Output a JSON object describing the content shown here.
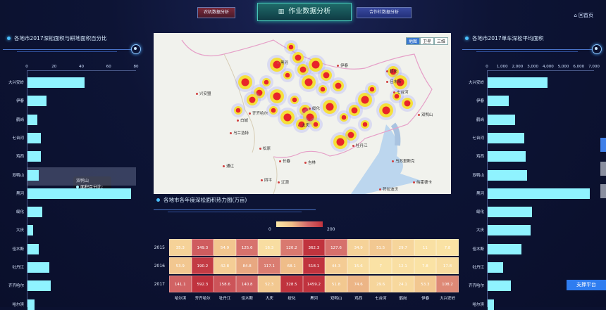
{
  "header": {
    "left_button": "农机数据分析",
    "main_button": "作业数据分析",
    "right_button": "合作社数据分析",
    "home_link": "回首页"
  },
  "left_panel": {
    "title": "各地市2017深松面积与耕地面积百分比",
    "axis_ticks": [
      "0",
      "20",
      "40",
      "60",
      "80"
    ],
    "tooltip": {
      "city": "双鸭山",
      "label": "面积百分比: 8.4"
    }
  },
  "right_panel": {
    "title": "各地市2017单车深松平均面积",
    "axis_ticks": [
      "0",
      "1,000",
      "2,000",
      "3,000",
      "4,000",
      "5,000",
      "6,000",
      "7,000"
    ]
  },
  "heatmap": {
    "title": "各地市各年度深松面积热力图(万亩)",
    "legend_min": "0",
    "legend_max": "200"
  },
  "map": {
    "toggle": [
      "地图",
      "卫星",
      "三维"
    ],
    "cities": [
      "伊春",
      "齐齐哈尔",
      "佳木斯",
      "牡丹江",
      "大庆",
      "长春",
      "绥化",
      "双鸭山",
      "鹤岗",
      "七台河",
      "白城",
      "松原",
      "四平",
      "吉林",
      "辽源",
      "通辽",
      "兴安盟",
      "乌苏里斯克",
      "纳霍德卡",
      "乌兰浩特",
      "符拉迪沃",
      "黑河"
    ]
  },
  "support_button": "支撑平台",
  "chart_data": [
    {
      "type": "bar",
      "title": "各地市2017深松面积与耕地面积百分比",
      "categories": [
        "大兴安岭",
        "伊春",
        "鹤岗",
        "七台河",
        "鸡西",
        "双鸭山",
        "黑河",
        "绥化",
        "大庆",
        "佳木斯",
        "牡丹江",
        "齐齐哈尔",
        "哈尔滨"
      ],
      "values": [
        42,
        14,
        7,
        10,
        10,
        8.4,
        76,
        11,
        4,
        8,
        16,
        17,
        5
      ],
      "xlim": [
        0,
        80
      ],
      "orientation": "horizontal"
    },
    {
      "type": "bar",
      "title": "各地市2017单车深松平均面积",
      "categories": [
        "大兴安岭",
        "伊春",
        "鹤岗",
        "七台河",
        "鸡西",
        "双鸭山",
        "黑河",
        "绥化",
        "大庆",
        "佳木斯",
        "牡丹江",
        "齐齐哈尔",
        "哈尔滨"
      ],
      "values": [
        3900,
        1400,
        1800,
        2400,
        2500,
        2600,
        6700,
        2900,
        2800,
        2200,
        1000,
        1500,
        400
      ],
      "xlim": [
        0,
        7000
      ],
      "orientation": "horizontal"
    },
    {
      "type": "heatmap",
      "title": "各地市各年度深松面积热力图(万亩)",
      "columns": [
        "哈尔滨",
        "齐齐哈尔",
        "牡丹江",
        "佳木斯",
        "大庆",
        "绥化",
        "黑河",
        "双鸭山",
        "鸡西",
        "七台河",
        "鹤岗",
        "伊春",
        "大兴安岭"
      ],
      "rows": [
        "2015",
        "2016",
        "2017"
      ],
      "values": [
        [
          "35.3",
          "149.3",
          "54.9",
          "125.6",
          "16.3",
          "120.2",
          "362.3",
          "127.6",
          "34.9",
          "51.5",
          "29.7",
          "11",
          "7.8"
        ],
        [
          "53.9",
          "190.2",
          "42.8",
          "84.8",
          "117.1",
          "68.1",
          "518.1",
          "44.3",
          "15.6",
          "7",
          "12.1",
          "7.8",
          "17.8"
        ],
        [
          "141.1",
          "592.3",
          "158.6",
          "140.8",
          "52.3",
          "328.5",
          "1459.2",
          "51.8",
          "74.6",
          "29.6",
          "24.1",
          "53.3",
          "108.2"
        ]
      ],
      "range": [
        0,
        200
      ]
    }
  ]
}
